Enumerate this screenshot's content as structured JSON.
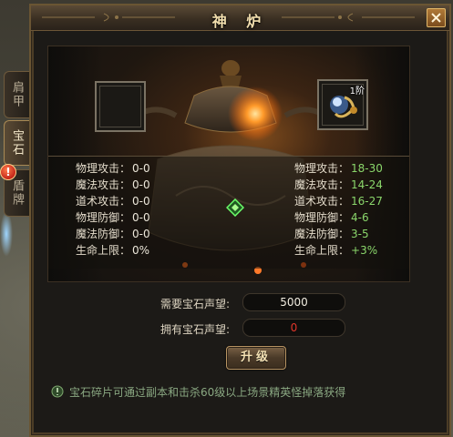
{
  "window": {
    "title": "神 炉",
    "close_icon": "close-x-icon"
  },
  "tabs": [
    {
      "label": "肩甲",
      "active": false
    },
    {
      "label": "宝石",
      "active": true
    },
    {
      "label": "盾牌",
      "active": false
    }
  ],
  "alert_badge": "!",
  "slots": {
    "left": {
      "empty": true
    },
    "right": {
      "icon": "gem-item-icon",
      "level_text": "1阶"
    }
  },
  "stats": {
    "current": [
      {
        "label": "物理攻击：",
        "value": "0-0"
      },
      {
        "label": "魔法攻击：",
        "value": "0-0"
      },
      {
        "label": "道术攻击：",
        "value": "0-0"
      },
      {
        "label": "物理防御：",
        "value": "0-0"
      },
      {
        "label": "魔法防御：",
        "value": "0-0"
      },
      {
        "label": "生命上限：",
        "value": "0%"
      }
    ],
    "next": [
      {
        "label": "物理攻击：",
        "value": "18-30"
      },
      {
        "label": "魔法攻击：",
        "value": "14-24"
      },
      {
        "label": "道术攻击：",
        "value": "16-27"
      },
      {
        "label": "物理防御：",
        "value": "4-6"
      },
      {
        "label": "魔法防御：",
        "value": "3-5"
      },
      {
        "label": "生命上限：",
        "value": "+3%"
      }
    ]
  },
  "form": {
    "required_label": "需要宝石声望:",
    "required_value": "5000",
    "owned_label": "拥有宝石声望:",
    "owned_value": "0",
    "upgrade_label": "升级"
  },
  "tip": {
    "icon": "info-icon",
    "text": "宝石碎片可通过副本和击杀60级以上场景精英怪掉落获得"
  },
  "colors": {
    "stat_next": "#8ad66b",
    "owned_insufficient": "#e0352a",
    "frame_gold": "#6a5533"
  }
}
